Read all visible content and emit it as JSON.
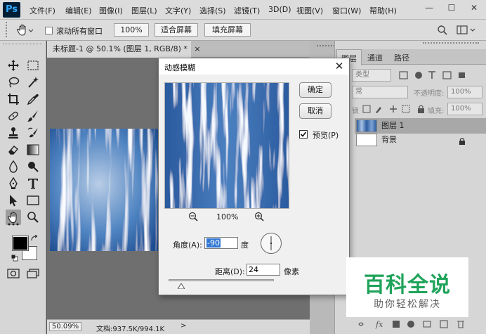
{
  "app": {
    "logo": "Ps"
  },
  "menu": [
    "文件(F)",
    "编辑(E)",
    "图像(I)",
    "图层(L)",
    "文字(Y)",
    "选择(S)",
    "滤镜(T)",
    "3D(D)",
    "视图(V)",
    "窗口(W)",
    "帮助(H)"
  ],
  "window_controls": {
    "minimize": "—",
    "restore": "☐",
    "close": "✕"
  },
  "options": {
    "scroll_all_label": "滚动所有窗口",
    "zoom_value": "100%",
    "fit_screen": "适合屏幕",
    "fill_screen": "填充屏幕"
  },
  "document": {
    "tab_title": "未标题-1 @ 50.1% (图层 1, RGB/8) *",
    "close": "×",
    "zoom": "50.09%",
    "doc_info": "文档:937.5K/994.1K",
    "status_arrow": ">"
  },
  "layers_panel": {
    "tabs": [
      "图层",
      "通道",
      "路径"
    ],
    "kind_filter": "类型",
    "blend_mode": "常",
    "opacity_label": "不透明度:",
    "opacity_value": "100%",
    "lock_label": "锁",
    "fill_label": "填充:",
    "fill_value": "100%",
    "layers": [
      {
        "name": "图层 1",
        "selected": true
      },
      {
        "name": "背景",
        "selected": false,
        "locked": true
      }
    ]
  },
  "dialog": {
    "title": "动感模糊",
    "close": "✕",
    "ok": "确定",
    "cancel": "取消",
    "preview_label": "预览(P)",
    "preview_checked": true,
    "zoom_value": "100%",
    "angle_label": "角度(A):",
    "angle_value": "-90",
    "angle_unit": "度",
    "distance_label": "距离(D):",
    "distance_value": "24",
    "distance_unit": "像素"
  },
  "watermark": {
    "main": "百科全说",
    "sub": "助你轻松解决"
  },
  "colors": {
    "menubar": "#dcdcdc",
    "toolbox": "#d6d6d6",
    "canvas_bg": "#6f6f6f",
    "dialog_bg": "#f0f0f0",
    "watermark_green": "#1fa35a",
    "blur_blue": "#3f76b8"
  },
  "icons": {
    "tools": [
      "move-tool-icon",
      "marquee-tool-icon",
      "lasso-tool-icon",
      "magic-wand-icon",
      "crop-tool-icon",
      "eyedropper-icon",
      "healing-brush-icon",
      "brush-tool-icon",
      "clone-stamp-icon",
      "history-brush-icon",
      "eraser-icon",
      "gradient-icon",
      "blur-tool-icon",
      "dodge-tool-icon",
      "pen-tool-icon",
      "type-tool-icon",
      "path-select-icon",
      "rectangle-tool-icon",
      "hand-tool-icon",
      "zoom-tool-icon"
    ]
  }
}
